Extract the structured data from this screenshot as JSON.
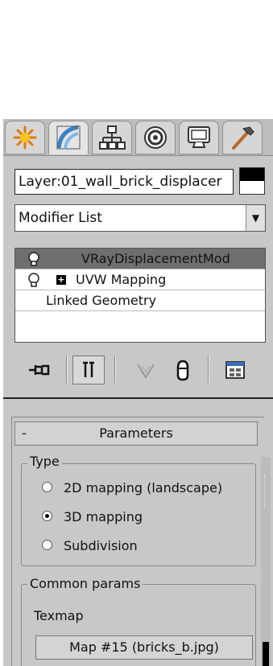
{
  "tabs": [
    {
      "icon": "create-icon",
      "active": false
    },
    {
      "icon": "modify-icon",
      "active": true
    },
    {
      "icon": "hierarchy-icon",
      "active": false
    },
    {
      "icon": "motion-icon",
      "active": false
    },
    {
      "icon": "display-icon",
      "active": false
    },
    {
      "icon": "utilities-icon",
      "active": false
    }
  ],
  "object": {
    "name": "Layer:01_wall_brick_displacer",
    "color_swatch": [
      "#000000",
      "#ffffff"
    ]
  },
  "modifier_list": {
    "label": "Modifier List"
  },
  "stack": {
    "items": [
      {
        "label": "VRayDisplacementMod",
        "selected": true
      },
      {
        "label": "UVW Mapping",
        "selected": false
      },
      {
        "label": "Linked Geometry",
        "selected": false
      }
    ]
  },
  "toolbar": {
    "buttons": [
      "pin-stack-icon",
      "show-end-result-icon",
      "make-unique-icon",
      "remove-modifier-icon",
      "configure-modifier-sets-icon"
    ]
  },
  "parameters": {
    "title": "Parameters",
    "collapse_symbol": "-",
    "type_group": {
      "label": "Type",
      "options": [
        {
          "label": "2D mapping (landscape)",
          "checked": false
        },
        {
          "label": "3D mapping",
          "checked": true
        },
        {
          "label": "Subdivision",
          "checked": false
        }
      ]
    },
    "common_group": {
      "label": "Common params",
      "texmap_label": "Texmap",
      "texmap_button": "Map #15 (bricks_b.jpg)"
    }
  }
}
